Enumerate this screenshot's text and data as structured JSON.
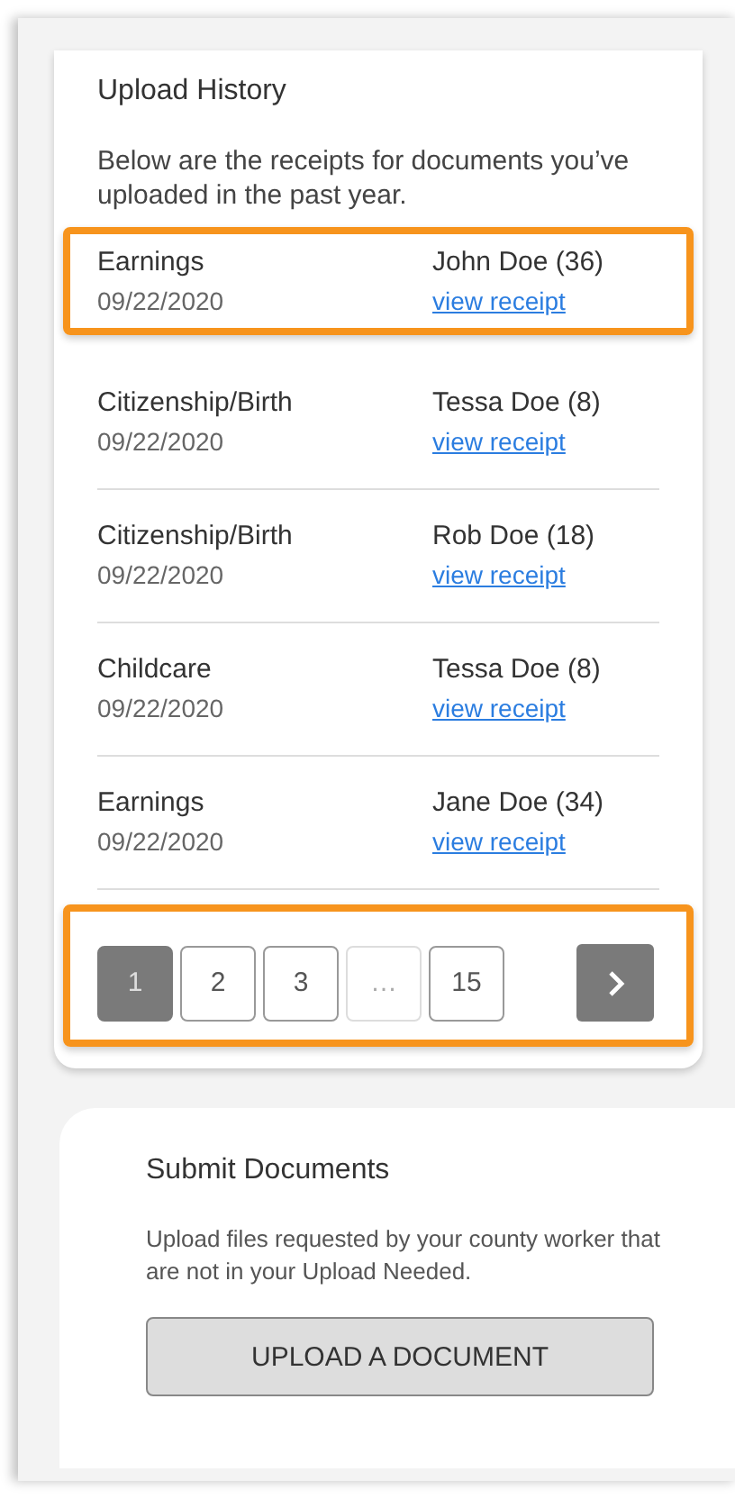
{
  "upload_history": {
    "title": "Upload History",
    "description": "Below are the receipts for documents you’ve uploaded in the past year.",
    "rows": [
      {
        "document": "Earnings",
        "date": "09/22/2020",
        "person": "John Doe (36)",
        "link": "view receipt",
        "highlighted": true
      },
      {
        "document": "Citizenship/Birth",
        "date": "09/22/2020",
        "person": "Tessa Doe (8)",
        "link": "view receipt",
        "highlighted": false
      },
      {
        "document": "Citizenship/Birth",
        "date": "09/22/2020",
        "person": "Rob Doe (18)",
        "link": "view receipt",
        "highlighted": false
      },
      {
        "document": "Childcare",
        "date": "09/22/2020",
        "person": "Tessa Doe (8)",
        "link": "view receipt",
        "highlighted": false
      },
      {
        "document": "Earnings",
        "date": "09/22/2020",
        "person": "Jane Doe (34)",
        "link": "view receipt",
        "highlighted": false
      }
    ],
    "pagination": {
      "highlighted": true,
      "pages": [
        {
          "label": "1",
          "selected": true,
          "disabled": false
        },
        {
          "label": "2",
          "selected": false,
          "disabled": false
        },
        {
          "label": "3",
          "selected": false,
          "disabled": false
        },
        {
          "label": "…",
          "selected": false,
          "disabled": true
        },
        {
          "label": "15",
          "selected": false,
          "disabled": false
        }
      ]
    }
  },
  "submit_documents": {
    "title": "Submit Documents",
    "description": "Upload files requested by your county worker that are not in your Upload Needed.",
    "button": "UPLOAD A DOCUMENT"
  }
}
